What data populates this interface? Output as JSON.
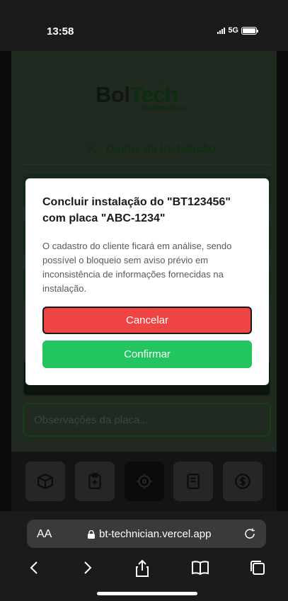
{
  "status": {
    "time": "13:58",
    "network": "5G"
  },
  "brand": {
    "name_main": "Bol",
    "name_accent": "Tech",
    "tagline": "Rastreadores"
  },
  "section": {
    "title": "Dados da Instalação",
    "icon": "user-gear-icon"
  },
  "observations": {
    "placeholder": "Observações da placa..."
  },
  "bottom_nav": {
    "items": [
      {
        "icon": "box-add-icon"
      },
      {
        "icon": "clipboard-add-icon"
      },
      {
        "icon": "crosshair-icon",
        "active": true
      },
      {
        "icon": "book-icon"
      },
      {
        "icon": "dollar-icon"
      }
    ]
  },
  "modal": {
    "title": "Concluir instalação do \"BT123456\" com placa \"ABC-1234\"",
    "message": "O cadastro do cliente ficará em análise, sendo possível o bloqueio sem aviso prévio em inconsistência de informações fornecidas na instalação.",
    "cancel_label": "Cancelar",
    "confirm_label": "Confirmar",
    "colors": {
      "cancel": "#ef4444",
      "confirm": "#22c55e"
    }
  },
  "browser": {
    "text_size_label": "AA",
    "url": "bt-technician.vercel.app"
  }
}
